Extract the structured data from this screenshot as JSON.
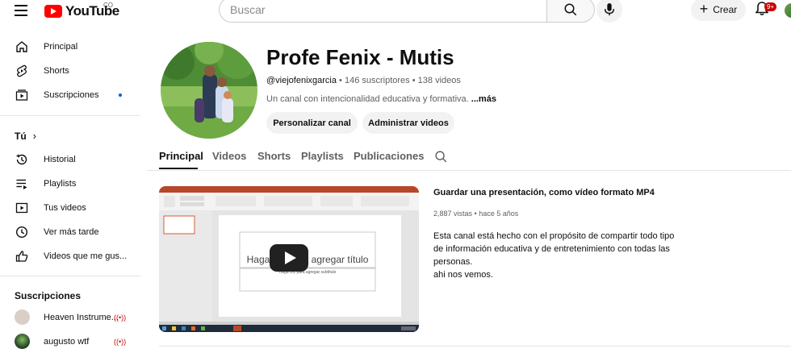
{
  "header": {
    "logo_text": "YouTube",
    "country_code": "CO",
    "search_placeholder": "Buscar",
    "create_label": "Crear",
    "notifications_badge": "9+"
  },
  "sidebar": {
    "main_items": [
      {
        "label": "Principal",
        "icon": "home-icon"
      },
      {
        "label": "Shorts",
        "icon": "shorts-icon"
      },
      {
        "label": "Suscripciones",
        "icon": "subscriptions-icon"
      }
    ],
    "you_heading": "Tú",
    "you_items": [
      {
        "label": "Historial",
        "icon": "history-icon"
      },
      {
        "label": "Playlists",
        "icon": "playlists-icon"
      },
      {
        "label": "Tus videos",
        "icon": "your-videos-icon"
      },
      {
        "label": "Ver más tarde",
        "icon": "watch-later-icon"
      },
      {
        "label": "Videos que me gus...",
        "icon": "like-icon"
      }
    ],
    "subs_heading": "Suscripciones",
    "subscriptions": [
      {
        "label": "Heaven Instrume...",
        "color": "#d9cfc6"
      },
      {
        "label": "augusto wtf",
        "color": "#2d4a2b"
      }
    ]
  },
  "channel": {
    "name": "Profe Fenix - Mutis",
    "handle": "@viejofenixgarcia",
    "subscribers": "146 suscriptores",
    "videos_count": "138 videos",
    "separator": " • ",
    "description": "Un canal con intencionalidad educativa y formativa.",
    "more_label": "...más",
    "customize_label": "Personalizar canal",
    "manage_label": "Administrar videos"
  },
  "tabs": [
    "Principal",
    "Videos",
    "Shorts",
    "Playlists",
    "Publicaciones"
  ],
  "featured": {
    "title": "Guardar una presentación,  como vídeo formato MP4",
    "views": "2,887 vistas",
    "age": "hace 5 años",
    "description_lines": [
      "Esta canal está hecho con el propósito de compartir todo tipo",
      "de información educativa y de entretenimiento  con todas las",
      "personas.",
      "ahi nos vemos."
    ],
    "thumb_slide_title": "Haga clic para agregar título",
    "thumb_slide_subtitle": "Haga clic para agregar subtítulo"
  },
  "colors": {
    "brand_red": "#ff0000",
    "badge_red": "#cc0000",
    "pill_bg": "#f2f2f2",
    "text_secondary": "#606060",
    "link_blue": "#065fd4",
    "taskbar": "#1f2a3a",
    "ppt_red": "#b7472a"
  }
}
